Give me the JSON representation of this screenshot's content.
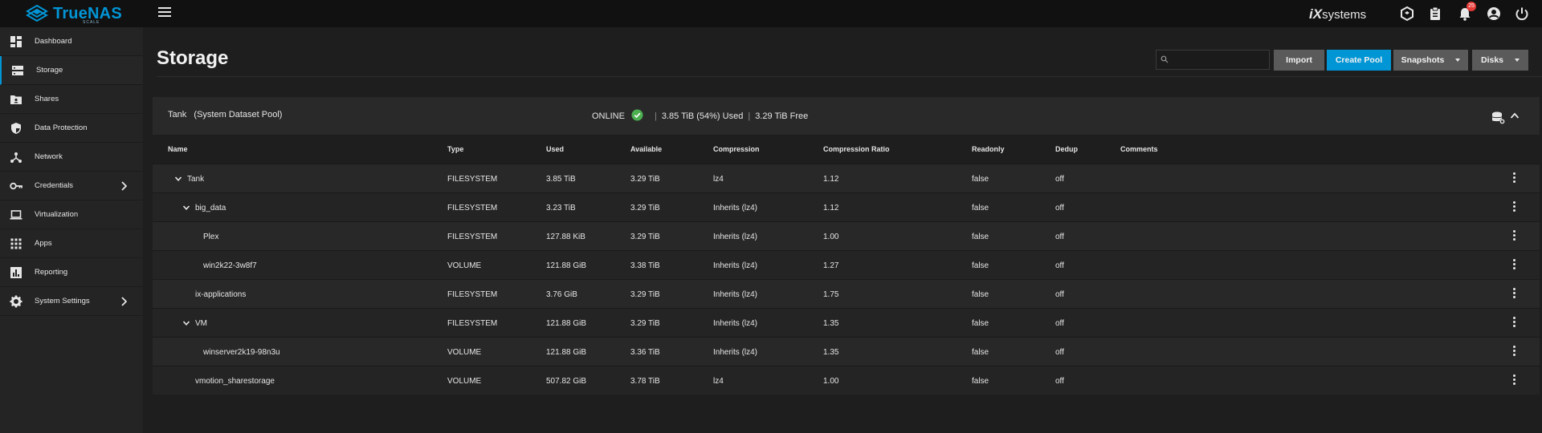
{
  "topbar": {
    "logo_text": "TrueNAS",
    "logo_sub": "SCALE",
    "brand_ix": "iX",
    "brand_rest": "systems",
    "notification_count": "25"
  },
  "sidebar": {
    "items": [
      {
        "label": "Dashboard",
        "icon": "dashboard-icon"
      },
      {
        "label": "Storage",
        "icon": "storage-icon"
      },
      {
        "label": "Shares",
        "icon": "shares-icon"
      },
      {
        "label": "Data Protection",
        "icon": "shield-icon"
      },
      {
        "label": "Network",
        "icon": "network-icon"
      },
      {
        "label": "Credentials",
        "icon": "key-icon"
      },
      {
        "label": "Virtualization",
        "icon": "laptop-icon"
      },
      {
        "label": "Apps",
        "icon": "apps-grid-icon"
      },
      {
        "label": "Reporting",
        "icon": "reporting-icon"
      },
      {
        "label": "System Settings",
        "icon": "gear-icon"
      }
    ]
  },
  "page": {
    "title": "Storage",
    "search_placeholder": "",
    "import_label": "Import",
    "create_pool_label": "Create Pool",
    "snapshots_label": "Snapshots",
    "disks_label": "Disks"
  },
  "pool": {
    "name": "Tank",
    "desc": "(System Dataset Pool)",
    "status": "ONLINE",
    "used": "3.85 TiB (54%) Used",
    "free": "3.29 TiB Free"
  },
  "table": {
    "columns": [
      "Name",
      "Type",
      "Used",
      "Available",
      "Compression",
      "Compression Ratio",
      "Readonly",
      "Dedup",
      "Comments"
    ],
    "rows": [
      {
        "name": "Tank",
        "type": "FILESYSTEM",
        "used": "3.85 TiB",
        "available": "3.29 TiB",
        "compression": "lz4",
        "ratio": "1.12",
        "readonly": "false",
        "dedup": "off",
        "comments": ""
      },
      {
        "name": "big_data",
        "type": "FILESYSTEM",
        "used": "3.23 TiB",
        "available": "3.29 TiB",
        "compression": "Inherits (lz4)",
        "ratio": "1.12",
        "readonly": "false",
        "dedup": "off",
        "comments": ""
      },
      {
        "name": "Plex",
        "type": "FILESYSTEM",
        "used": "127.88 KiB",
        "available": "3.29 TiB",
        "compression": "Inherits (lz4)",
        "ratio": "1.00",
        "readonly": "false",
        "dedup": "off",
        "comments": ""
      },
      {
        "name": "win2k22-3w8f7",
        "type": "VOLUME",
        "used": "121.88 GiB",
        "available": "3.38 TiB",
        "compression": "Inherits (lz4)",
        "ratio": "1.27",
        "readonly": "false",
        "dedup": "off",
        "comments": ""
      },
      {
        "name": "ix-applications",
        "type": "FILESYSTEM",
        "used": "3.76 GiB",
        "available": "3.29 TiB",
        "compression": "Inherits (lz4)",
        "ratio": "1.75",
        "readonly": "false",
        "dedup": "off",
        "comments": ""
      },
      {
        "name": "VM",
        "type": "FILESYSTEM",
        "used": "121.88 GiB",
        "available": "3.29 TiB",
        "compression": "Inherits (lz4)",
        "ratio": "1.35",
        "readonly": "false",
        "dedup": "off",
        "comments": ""
      },
      {
        "name": "winserver2k19-98n3u",
        "type": "VOLUME",
        "used": "121.88 GiB",
        "available": "3.36 TiB",
        "compression": "Inherits (lz4)",
        "ratio": "1.35",
        "readonly": "false",
        "dedup": "off",
        "comments": ""
      },
      {
        "name": "vmotion_sharestorage",
        "type": "VOLUME",
        "used": "507.82 GiB",
        "available": "3.78 TiB",
        "compression": "lz4",
        "ratio": "1.00",
        "readonly": "false",
        "dedup": "off",
        "comments": ""
      }
    ]
  },
  "colors": {
    "accent": "#0095d5",
    "ok_green": "#4caf50",
    "badge_red": "#e53935"
  }
}
